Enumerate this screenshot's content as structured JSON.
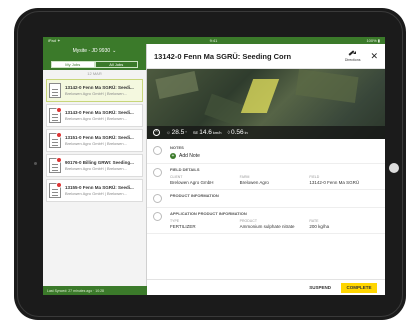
{
  "status_bar": {
    "left": "iPad ✦",
    "center": "9:41",
    "right": "100% ▮"
  },
  "sidebar": {
    "header_title": "Mysite - JD 9930",
    "header_chevron": "⌄",
    "segments": [
      "My Jobs",
      "All Jobs"
    ],
    "date_divider": "12 MAR",
    "jobs": [
      {
        "title": "13142-0 Fenn Ma SGRÜ: Seedi...",
        "subtitle": "Brelowen Agro GmbH | Brelowen...",
        "selected": true,
        "badge": false
      },
      {
        "title": "13143-0 Fenn Ma SGRÜ: Seedi...",
        "subtitle": "Brelowen Agro GmbH | Brelowen...",
        "selected": false,
        "badge": true
      },
      {
        "title": "13151-0 Fenn Ma SGRÜ: Seedi...",
        "subtitle": "Brelowen Agro GmbH | Brelowen...",
        "selected": false,
        "badge": true
      },
      {
        "title": "90176-0 Billing GRWI: Seeding...",
        "subtitle": "Brelowen Agro GmbH | Brelowen...",
        "selected": false,
        "badge": true
      },
      {
        "title": "13155-0 Fenn Ma SGRÜ: Seedi...",
        "subtitle": "Brelowen Agro GmbH | Brelowen...",
        "selected": false,
        "badge": true
      }
    ],
    "footer": "Last Synced: 27 minutes ago · 10:28"
  },
  "detail": {
    "title": "13142-0 Fenn Ma SGRÜ: Seeding Corn",
    "directions_label": "Directions",
    "close_label": "✕",
    "weather": {
      "collapse": "⌃",
      "temp": "28.5",
      "temp_unit": "°",
      "wind_dir": "SE",
      "wind": "14.6",
      "wind_unit": "km/h",
      "rain": "0.56",
      "rain_unit": "in"
    },
    "notes": {
      "title": "Notes",
      "add_label": "Add Note"
    },
    "field_details": {
      "title": "Field Details",
      "columns": [
        {
          "label": "Client",
          "value": "Brelowen Agro GmbH"
        },
        {
          "label": "Farm",
          "value": "Brelowen Agro"
        },
        {
          "label": "Field",
          "value": "13142-0 Fenn Ma SGRÜ"
        }
      ]
    },
    "product_info": {
      "title": "Product Information"
    },
    "application_info": {
      "title": "Application Product Information",
      "columns": [
        {
          "label": "Type",
          "value": "FERTILIZER"
        },
        {
          "label": "Product",
          "value": "Ammonium sulphate nitrate"
        },
        {
          "label": "Rate",
          "value": "200 kg/ha"
        }
      ]
    },
    "actions": {
      "suspend": "SUSPEND",
      "complete": "COMPLETE"
    }
  }
}
